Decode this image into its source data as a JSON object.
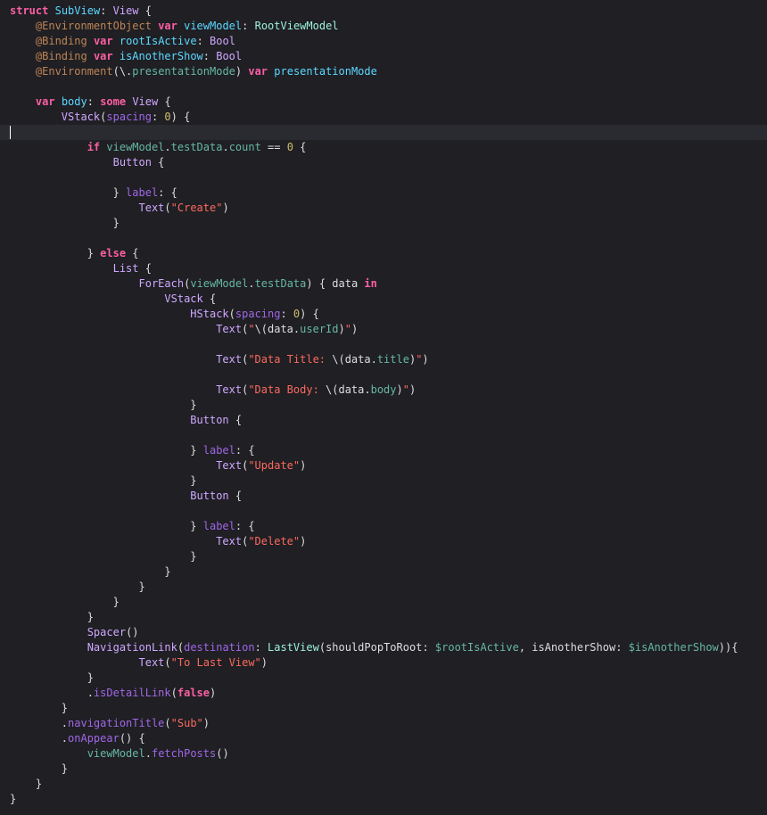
{
  "editor": {
    "language": "swift",
    "theme": "dark",
    "current_line": 9,
    "colors": {
      "background": "#1f1f24",
      "current_line_highlight": "#2a2b30",
      "plain": "#dfdfe0",
      "keyword": "#fc5fa3",
      "type_declaration": "#5dd8ff",
      "type": "#d0a8ff",
      "project_type": "#9ef1dd",
      "property": "#67b7a4",
      "function": "#a167e6",
      "string": "#fc6a5d",
      "number": "#d0bf69",
      "attribute": "#bf8555"
    },
    "lines": [
      [
        [
          "kw",
          "struct"
        ],
        [
          "plain",
          " "
        ],
        [
          "typedecl",
          "SubView"
        ],
        [
          "plain",
          ": "
        ],
        [
          "type",
          "View"
        ],
        [
          "plain",
          " {"
        ]
      ],
      [
        [
          "plain",
          "    "
        ],
        [
          "attr",
          "@EnvironmentObject"
        ],
        [
          "plain",
          " "
        ],
        [
          "kw",
          "var"
        ],
        [
          "plain",
          " "
        ],
        [
          "typedecl",
          "viewModel"
        ],
        [
          "plain",
          ": "
        ],
        [
          "proj",
          "RootViewModel"
        ]
      ],
      [
        [
          "plain",
          "    "
        ],
        [
          "attr",
          "@Binding"
        ],
        [
          "plain",
          " "
        ],
        [
          "kw",
          "var"
        ],
        [
          "plain",
          " "
        ],
        [
          "typedecl",
          "rootIsActive"
        ],
        [
          "plain",
          ": "
        ],
        [
          "type",
          "Bool"
        ]
      ],
      [
        [
          "plain",
          "    "
        ],
        [
          "attr",
          "@Binding"
        ],
        [
          "plain",
          " "
        ],
        [
          "kw",
          "var"
        ],
        [
          "plain",
          " "
        ],
        [
          "typedecl",
          "isAnotherShow"
        ],
        [
          "plain",
          ": "
        ],
        [
          "type",
          "Bool"
        ]
      ],
      [
        [
          "plain",
          "    "
        ],
        [
          "attr",
          "@Environment"
        ],
        [
          "plain",
          "(\\."
        ],
        [
          "prop",
          "presentationMode"
        ],
        [
          "plain",
          ") "
        ],
        [
          "kw",
          "var"
        ],
        [
          "plain",
          " "
        ],
        [
          "typedecl",
          "presentationMode"
        ]
      ],
      [],
      [
        [
          "plain",
          "    "
        ],
        [
          "kw",
          "var"
        ],
        [
          "plain",
          " "
        ],
        [
          "typedecl",
          "body"
        ],
        [
          "plain",
          ": "
        ],
        [
          "kw",
          "some"
        ],
        [
          "plain",
          " "
        ],
        [
          "type",
          "View"
        ],
        [
          "plain",
          " {"
        ]
      ],
      [
        [
          "plain",
          "        "
        ],
        [
          "type",
          "VStack"
        ],
        [
          "plain",
          "("
        ],
        [
          "func",
          "spacing"
        ],
        [
          "plain",
          ": "
        ],
        [
          "num",
          "0"
        ],
        [
          "plain",
          ") {"
        ]
      ],
      [],
      [
        [
          "plain",
          "            "
        ],
        [
          "kw",
          "if"
        ],
        [
          "plain",
          " "
        ],
        [
          "prop",
          "viewModel"
        ],
        [
          "plain",
          "."
        ],
        [
          "prop",
          "testData"
        ],
        [
          "plain",
          "."
        ],
        [
          "prop",
          "count"
        ],
        [
          "plain",
          " == "
        ],
        [
          "num",
          "0"
        ],
        [
          "plain",
          " {"
        ]
      ],
      [
        [
          "plain",
          "                "
        ],
        [
          "type",
          "Button"
        ],
        [
          "plain",
          " {"
        ]
      ],
      [],
      [
        [
          "plain",
          "                } "
        ],
        [
          "func",
          "label"
        ],
        [
          "plain",
          ": {"
        ]
      ],
      [
        [
          "plain",
          "                    "
        ],
        [
          "type",
          "Text"
        ],
        [
          "plain",
          "("
        ],
        [
          "str",
          "\"Create\""
        ],
        [
          "plain",
          ")"
        ]
      ],
      [
        [
          "plain",
          "                }"
        ]
      ],
      [],
      [
        [
          "plain",
          "            } "
        ],
        [
          "kw",
          "else"
        ],
        [
          "plain",
          " {"
        ]
      ],
      [
        [
          "plain",
          "                "
        ],
        [
          "type",
          "List"
        ],
        [
          "plain",
          " {"
        ]
      ],
      [
        [
          "plain",
          "                    "
        ],
        [
          "type",
          "ForEach"
        ],
        [
          "plain",
          "("
        ],
        [
          "prop",
          "viewModel"
        ],
        [
          "plain",
          "."
        ],
        [
          "prop",
          "testData"
        ],
        [
          "plain",
          ") { data "
        ],
        [
          "kw",
          "in"
        ]
      ],
      [
        [
          "plain",
          "                        "
        ],
        [
          "type",
          "VStack"
        ],
        [
          "plain",
          " {"
        ]
      ],
      [
        [
          "plain",
          "                            "
        ],
        [
          "type",
          "HStack"
        ],
        [
          "plain",
          "("
        ],
        [
          "func",
          "spacing"
        ],
        [
          "plain",
          ": "
        ],
        [
          "num",
          "0"
        ],
        [
          "plain",
          ") {"
        ]
      ],
      [
        [
          "plain",
          "                                "
        ],
        [
          "type",
          "Text"
        ],
        [
          "plain",
          "("
        ],
        [
          "str",
          "\""
        ],
        [
          "plain",
          "\\(data."
        ],
        [
          "prop",
          "userId"
        ],
        [
          "plain",
          ")"
        ],
        [
          "str",
          "\""
        ],
        [
          "plain",
          ")"
        ]
      ],
      [],
      [
        [
          "plain",
          "                                "
        ],
        [
          "type",
          "Text"
        ],
        [
          "plain",
          "("
        ],
        [
          "str",
          "\"Data Title: "
        ],
        [
          "plain",
          "\\(data."
        ],
        [
          "prop",
          "title"
        ],
        [
          "plain",
          ")"
        ],
        [
          "str",
          "\""
        ],
        [
          "plain",
          ")"
        ]
      ],
      [],
      [
        [
          "plain",
          "                                "
        ],
        [
          "type",
          "Text"
        ],
        [
          "plain",
          "("
        ],
        [
          "str",
          "\"Data Body: "
        ],
        [
          "plain",
          "\\(data."
        ],
        [
          "prop",
          "body"
        ],
        [
          "plain",
          ")"
        ],
        [
          "str",
          "\""
        ],
        [
          "plain",
          ")"
        ]
      ],
      [
        [
          "plain",
          "                            }"
        ]
      ],
      [
        [
          "plain",
          "                            "
        ],
        [
          "type",
          "Button"
        ],
        [
          "plain",
          " {"
        ]
      ],
      [],
      [
        [
          "plain",
          "                            } "
        ],
        [
          "func",
          "label"
        ],
        [
          "plain",
          ": {"
        ]
      ],
      [
        [
          "plain",
          "                                "
        ],
        [
          "type",
          "Text"
        ],
        [
          "plain",
          "("
        ],
        [
          "str",
          "\"Update\""
        ],
        [
          "plain",
          ")"
        ]
      ],
      [
        [
          "plain",
          "                            }"
        ]
      ],
      [
        [
          "plain",
          "                            "
        ],
        [
          "type",
          "Button"
        ],
        [
          "plain",
          " {"
        ]
      ],
      [],
      [
        [
          "plain",
          "                            } "
        ],
        [
          "func",
          "label"
        ],
        [
          "plain",
          ": {"
        ]
      ],
      [
        [
          "plain",
          "                                "
        ],
        [
          "type",
          "Text"
        ],
        [
          "plain",
          "("
        ],
        [
          "str",
          "\"Delete\""
        ],
        [
          "plain",
          ")"
        ]
      ],
      [
        [
          "plain",
          "                            }"
        ]
      ],
      [
        [
          "plain",
          "                        }"
        ]
      ],
      [
        [
          "plain",
          "                    }"
        ]
      ],
      [
        [
          "plain",
          "                }"
        ]
      ],
      [
        [
          "plain",
          "            }"
        ]
      ],
      [
        [
          "plain",
          "            "
        ],
        [
          "type",
          "Spacer"
        ],
        [
          "plain",
          "()"
        ]
      ],
      [
        [
          "plain",
          "            "
        ],
        [
          "type",
          "NavigationLink"
        ],
        [
          "plain",
          "("
        ],
        [
          "func",
          "destination"
        ],
        [
          "plain",
          ": "
        ],
        [
          "proj",
          "LastView"
        ],
        [
          "plain",
          "("
        ],
        [
          "plain",
          "shouldPopToRoot"
        ],
        [
          "plain",
          ": "
        ],
        [
          "prop",
          "$rootIsActive"
        ],
        [
          "plain",
          ", "
        ],
        [
          "plain",
          "isAnotherShow"
        ],
        [
          "plain",
          ": "
        ],
        [
          "prop",
          "$isAnotherShow"
        ],
        [
          "plain",
          "))"
        ],
        [
          "plain",
          "{"
        ]
      ],
      [
        [
          "plain",
          "                    "
        ],
        [
          "type",
          "Text"
        ],
        [
          "plain",
          "("
        ],
        [
          "str",
          "\"To Last View\""
        ],
        [
          "plain",
          ")"
        ]
      ],
      [
        [
          "plain",
          "            }"
        ]
      ],
      [
        [
          "plain",
          "            ."
        ],
        [
          "func",
          "isDetailLink"
        ],
        [
          "plain",
          "("
        ],
        [
          "kw",
          "false"
        ],
        [
          "plain",
          ")"
        ]
      ],
      [
        [
          "plain",
          "        }"
        ]
      ],
      [
        [
          "plain",
          "        ."
        ],
        [
          "func",
          "navigationTitle"
        ],
        [
          "plain",
          "("
        ],
        [
          "str",
          "\"Sub\""
        ],
        [
          "plain",
          ")"
        ]
      ],
      [
        [
          "plain",
          "        ."
        ],
        [
          "func",
          "onAppear"
        ],
        [
          "plain",
          "() {"
        ]
      ],
      [
        [
          "plain",
          "            "
        ],
        [
          "prop",
          "viewModel"
        ],
        [
          "plain",
          "."
        ],
        [
          "func",
          "fetchPosts"
        ],
        [
          "plain",
          "()"
        ]
      ],
      [
        [
          "plain",
          "        }"
        ]
      ],
      [
        [
          "plain",
          "    }"
        ]
      ],
      [
        [
          "plain",
          "}"
        ]
      ]
    ]
  }
}
